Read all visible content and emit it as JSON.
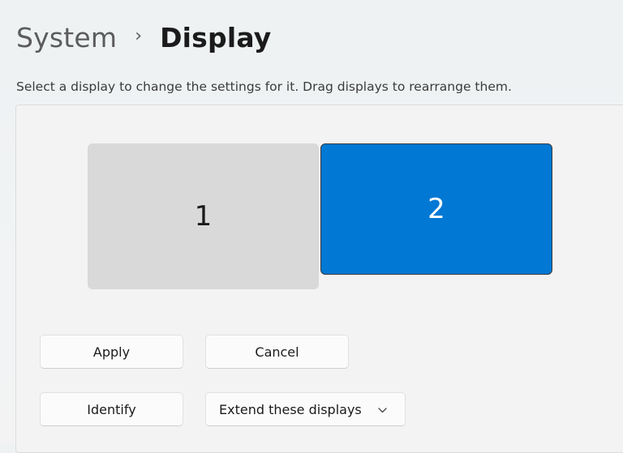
{
  "breadcrumb": {
    "parent": "System",
    "separator": "›",
    "current": "Display"
  },
  "subtitle": "Select a display to change the settings for it. Drag displays to rearrange them.",
  "monitors": [
    {
      "label": "1",
      "selected": false,
      "color": "#d9d9d9"
    },
    {
      "label": "2",
      "selected": true,
      "color": "#0078d4"
    }
  ],
  "buttons": {
    "apply": "Apply",
    "cancel": "Cancel",
    "identify": "Identify"
  },
  "display_mode": {
    "selected": "Extend these displays",
    "icon": "chevron-down-icon"
  },
  "colors": {
    "accent": "#0078d4"
  }
}
